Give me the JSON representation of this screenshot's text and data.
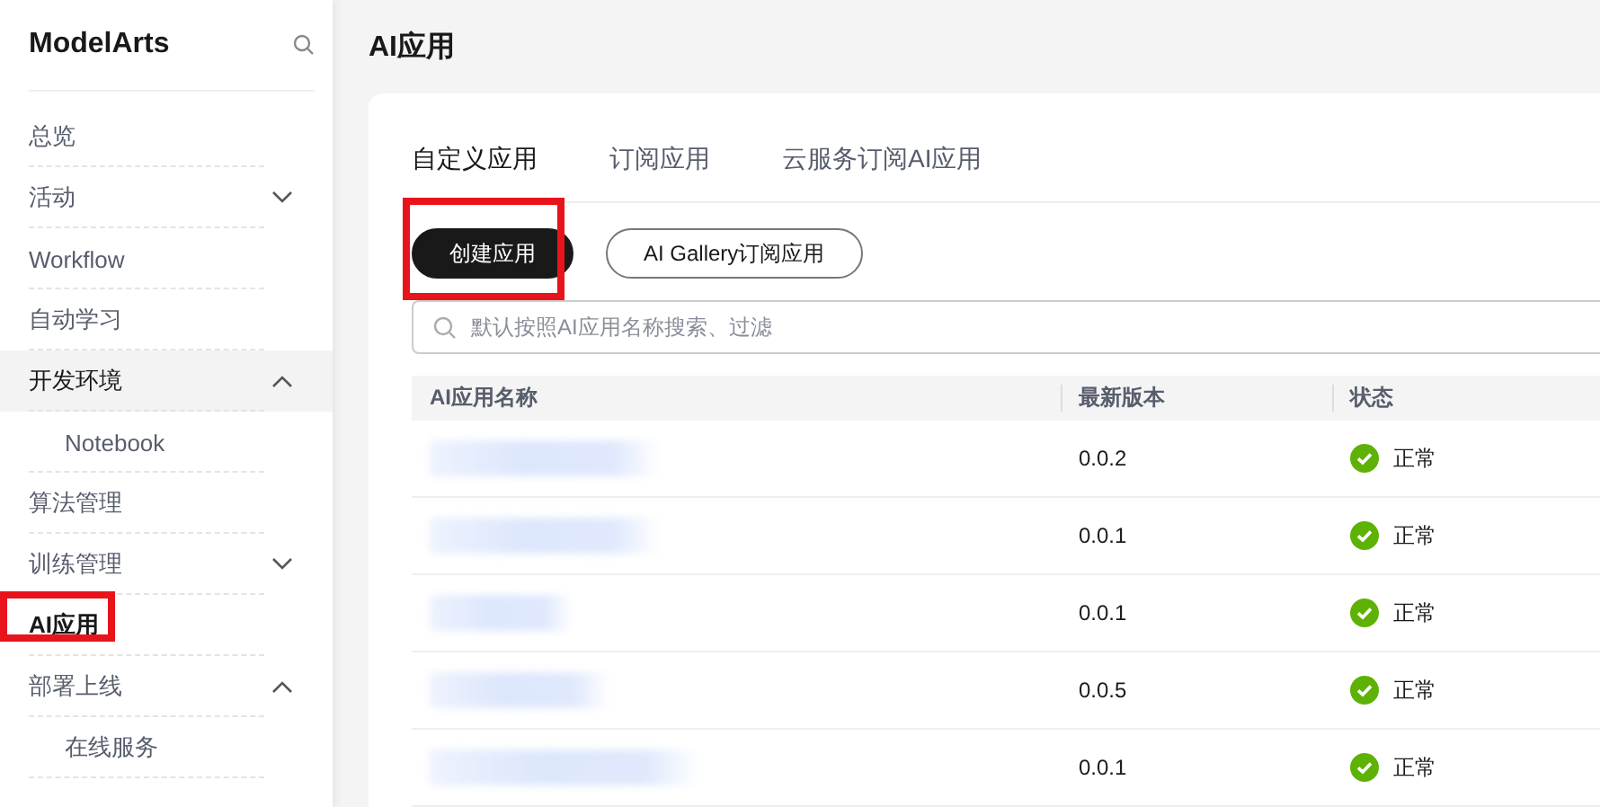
{
  "sidebar": {
    "title": "ModelArts",
    "items": [
      {
        "label": "总览",
        "selected": false
      },
      {
        "label": "活动",
        "selected": false,
        "expanded": false
      },
      {
        "label": "Workflow",
        "selected": false
      },
      {
        "label": "自动学习",
        "selected": false
      },
      {
        "label": "开发环境",
        "selected": false,
        "expanded": true,
        "hovered": true,
        "children": [
          {
            "label": "Notebook",
            "selected": false
          }
        ]
      },
      {
        "label": "算法管理",
        "selected": false
      },
      {
        "label": "训练管理",
        "selected": false,
        "expanded": false
      },
      {
        "label": "AI应用",
        "selected": true,
        "highlighted": true
      },
      {
        "label": "部署上线",
        "selected": false,
        "expanded": true,
        "children": [
          {
            "label": "在线服务",
            "selected": false
          }
        ]
      }
    ]
  },
  "page_title": "AI应用",
  "tabs": [
    {
      "label": "自定义应用",
      "selected": true
    },
    {
      "label": "订阅应用",
      "selected": false
    },
    {
      "label": "云服务订阅AI应用",
      "selected": false
    }
  ],
  "buttons": [
    {
      "label": "创建应用",
      "kind": "primary",
      "highlighted": true
    },
    {
      "label": "AI Gallery订阅应用",
      "kind": "secondary",
      "highlighted": false
    }
  ],
  "search": {
    "placeholder": "默认按照AI应用名称搜索、过滤"
  },
  "table": {
    "columns": [
      "AI应用名称",
      "最新版本",
      "状态"
    ],
    "rows": [
      {
        "name": {
          "kind": "redacted"
        },
        "version": "0.0.2",
        "status": {
          "kind": "normal",
          "label": "正常"
        }
      },
      {
        "name": {
          "kind": "redacted"
        },
        "version": "0.0.1",
        "status": {
          "kind": "normal",
          "label": "正常"
        }
      },
      {
        "name": {
          "kind": "redacted"
        },
        "version": "0.0.1",
        "status": {
          "kind": "normal",
          "label": "正常"
        }
      },
      {
        "name": {
          "kind": "redacted"
        },
        "version": "0.0.5",
        "status": {
          "kind": "normal",
          "label": "正常"
        }
      },
      {
        "name": {
          "kind": "redacted"
        },
        "version": "0.0.1",
        "status": {
          "kind": "normal",
          "label": "正常"
        }
      }
    ]
  }
}
